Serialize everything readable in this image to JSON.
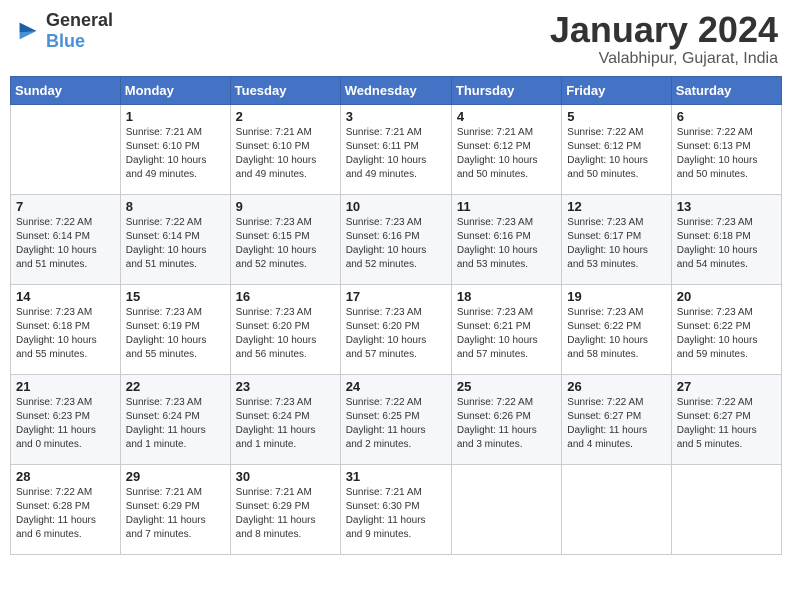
{
  "header": {
    "logo_general": "General",
    "logo_blue": "Blue",
    "title": "January 2024",
    "subtitle": "Valabhipur, Gujarat, India"
  },
  "days_of_week": [
    "Sunday",
    "Monday",
    "Tuesday",
    "Wednesday",
    "Thursday",
    "Friday",
    "Saturday"
  ],
  "weeks": [
    [
      {
        "day": "",
        "info": ""
      },
      {
        "day": "1",
        "info": "Sunrise: 7:21 AM\nSunset: 6:10 PM\nDaylight: 10 hours\nand 49 minutes."
      },
      {
        "day": "2",
        "info": "Sunrise: 7:21 AM\nSunset: 6:10 PM\nDaylight: 10 hours\nand 49 minutes."
      },
      {
        "day": "3",
        "info": "Sunrise: 7:21 AM\nSunset: 6:11 PM\nDaylight: 10 hours\nand 49 minutes."
      },
      {
        "day": "4",
        "info": "Sunrise: 7:21 AM\nSunset: 6:12 PM\nDaylight: 10 hours\nand 50 minutes."
      },
      {
        "day": "5",
        "info": "Sunrise: 7:22 AM\nSunset: 6:12 PM\nDaylight: 10 hours\nand 50 minutes."
      },
      {
        "day": "6",
        "info": "Sunrise: 7:22 AM\nSunset: 6:13 PM\nDaylight: 10 hours\nand 50 minutes."
      }
    ],
    [
      {
        "day": "7",
        "info": "Sunrise: 7:22 AM\nSunset: 6:14 PM\nDaylight: 10 hours\nand 51 minutes."
      },
      {
        "day": "8",
        "info": "Sunrise: 7:22 AM\nSunset: 6:14 PM\nDaylight: 10 hours\nand 51 minutes."
      },
      {
        "day": "9",
        "info": "Sunrise: 7:23 AM\nSunset: 6:15 PM\nDaylight: 10 hours\nand 52 minutes."
      },
      {
        "day": "10",
        "info": "Sunrise: 7:23 AM\nSunset: 6:16 PM\nDaylight: 10 hours\nand 52 minutes."
      },
      {
        "day": "11",
        "info": "Sunrise: 7:23 AM\nSunset: 6:16 PM\nDaylight: 10 hours\nand 53 minutes."
      },
      {
        "day": "12",
        "info": "Sunrise: 7:23 AM\nSunset: 6:17 PM\nDaylight: 10 hours\nand 53 minutes."
      },
      {
        "day": "13",
        "info": "Sunrise: 7:23 AM\nSunset: 6:18 PM\nDaylight: 10 hours\nand 54 minutes."
      }
    ],
    [
      {
        "day": "14",
        "info": "Sunrise: 7:23 AM\nSunset: 6:18 PM\nDaylight: 10 hours\nand 55 minutes."
      },
      {
        "day": "15",
        "info": "Sunrise: 7:23 AM\nSunset: 6:19 PM\nDaylight: 10 hours\nand 55 minutes."
      },
      {
        "day": "16",
        "info": "Sunrise: 7:23 AM\nSunset: 6:20 PM\nDaylight: 10 hours\nand 56 minutes."
      },
      {
        "day": "17",
        "info": "Sunrise: 7:23 AM\nSunset: 6:20 PM\nDaylight: 10 hours\nand 57 minutes."
      },
      {
        "day": "18",
        "info": "Sunrise: 7:23 AM\nSunset: 6:21 PM\nDaylight: 10 hours\nand 57 minutes."
      },
      {
        "day": "19",
        "info": "Sunrise: 7:23 AM\nSunset: 6:22 PM\nDaylight: 10 hours\nand 58 minutes."
      },
      {
        "day": "20",
        "info": "Sunrise: 7:23 AM\nSunset: 6:22 PM\nDaylight: 10 hours\nand 59 minutes."
      }
    ],
    [
      {
        "day": "21",
        "info": "Sunrise: 7:23 AM\nSunset: 6:23 PM\nDaylight: 11 hours\nand 0 minutes."
      },
      {
        "day": "22",
        "info": "Sunrise: 7:23 AM\nSunset: 6:24 PM\nDaylight: 11 hours\nand 1 minute."
      },
      {
        "day": "23",
        "info": "Sunrise: 7:23 AM\nSunset: 6:24 PM\nDaylight: 11 hours\nand 1 minute."
      },
      {
        "day": "24",
        "info": "Sunrise: 7:22 AM\nSunset: 6:25 PM\nDaylight: 11 hours\nand 2 minutes."
      },
      {
        "day": "25",
        "info": "Sunrise: 7:22 AM\nSunset: 6:26 PM\nDaylight: 11 hours\nand 3 minutes."
      },
      {
        "day": "26",
        "info": "Sunrise: 7:22 AM\nSunset: 6:27 PM\nDaylight: 11 hours\nand 4 minutes."
      },
      {
        "day": "27",
        "info": "Sunrise: 7:22 AM\nSunset: 6:27 PM\nDaylight: 11 hours\nand 5 minutes."
      }
    ],
    [
      {
        "day": "28",
        "info": "Sunrise: 7:22 AM\nSunset: 6:28 PM\nDaylight: 11 hours\nand 6 minutes."
      },
      {
        "day": "29",
        "info": "Sunrise: 7:21 AM\nSunset: 6:29 PM\nDaylight: 11 hours\nand 7 minutes."
      },
      {
        "day": "30",
        "info": "Sunrise: 7:21 AM\nSunset: 6:29 PM\nDaylight: 11 hours\nand 8 minutes."
      },
      {
        "day": "31",
        "info": "Sunrise: 7:21 AM\nSunset: 6:30 PM\nDaylight: 11 hours\nand 9 minutes."
      },
      {
        "day": "",
        "info": ""
      },
      {
        "day": "",
        "info": ""
      },
      {
        "day": "",
        "info": ""
      }
    ]
  ]
}
